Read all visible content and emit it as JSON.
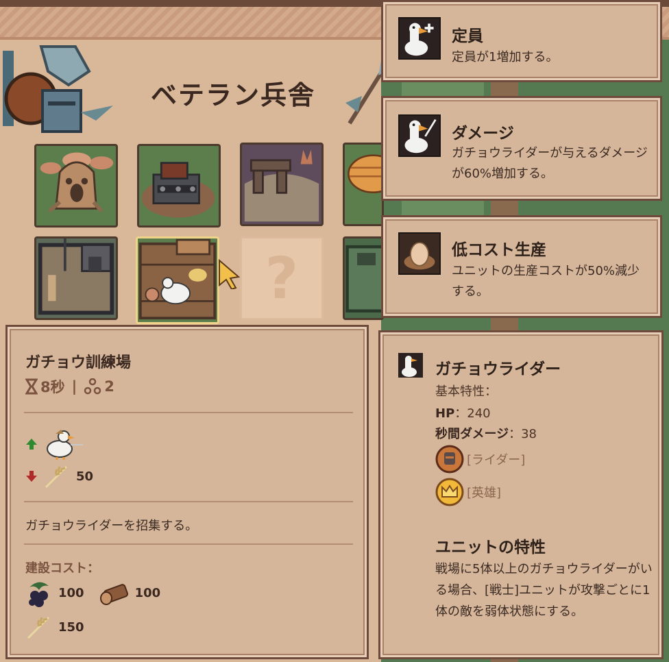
{
  "screen": {
    "title": "ベテラン兵舎"
  },
  "building_grid": {
    "tiles": [
      {
        "name": "mushroom-tree-building"
      },
      {
        "name": "tank-workshop-building"
      },
      {
        "name": "dolmen-building"
      },
      {
        "name": "beehive-building"
      },
      {
        "name": "fortress-building"
      },
      {
        "name": "goose-training-ground-building",
        "selected": true
      },
      {
        "name": "locked-building",
        "label": "?"
      },
      {
        "name": "green-hall-building"
      }
    ]
  },
  "upgrades": [
    {
      "icon": "goose-plus-icon",
      "title": "定員",
      "desc": "定員が1増加する。"
    },
    {
      "icon": "goose-sword-icon",
      "title": "ダメージ",
      "desc": "ガチョウライダーが与えるダメージが60%増加する。"
    },
    {
      "icon": "egg-nest-icon",
      "title": "低コスト生産",
      "desc": "ユニットの生産コストが50%減少する。"
    }
  ],
  "building_panel": {
    "name": "ガチョウ訓練場",
    "time": "8秒",
    "separator": "|",
    "slots": "2",
    "produce_value": "",
    "consume_value": "50",
    "description": "ガチョウライダーを招集する。",
    "cost_label": "建設コスト：",
    "costs": [
      {
        "icon": "berry-icon",
        "value": "100"
      },
      {
        "icon": "log-icon",
        "value": "100"
      },
      {
        "icon": "wheat-icon",
        "value": "150"
      }
    ]
  },
  "unit_panel": {
    "name": "ガチョウライダー",
    "base_label": "基本特性：",
    "hp_label": "HP",
    "hp_value": "：240",
    "dps_label": "秒間ダメージ",
    "dps_value": "：38",
    "tags": [
      {
        "icon": "rider-badge-icon",
        "label": "[ライダー]"
      },
      {
        "icon": "hero-crown-icon",
        "label": "[英雄]"
      }
    ],
    "trait_title": "ユニットの特性",
    "trait_desc": "戦場に5体以上のガチョウライダーがいる場合、[戦士]ユニットが攻撃ごとに1体の敵を弱体状態にする。"
  },
  "colors": {
    "panel_bg": "#d6b69a",
    "panel_border": "#6d4a3c",
    "up_arrow": "#2e8a2e",
    "down_arrow": "#b02a2a",
    "tag_text": "#8a6650"
  }
}
